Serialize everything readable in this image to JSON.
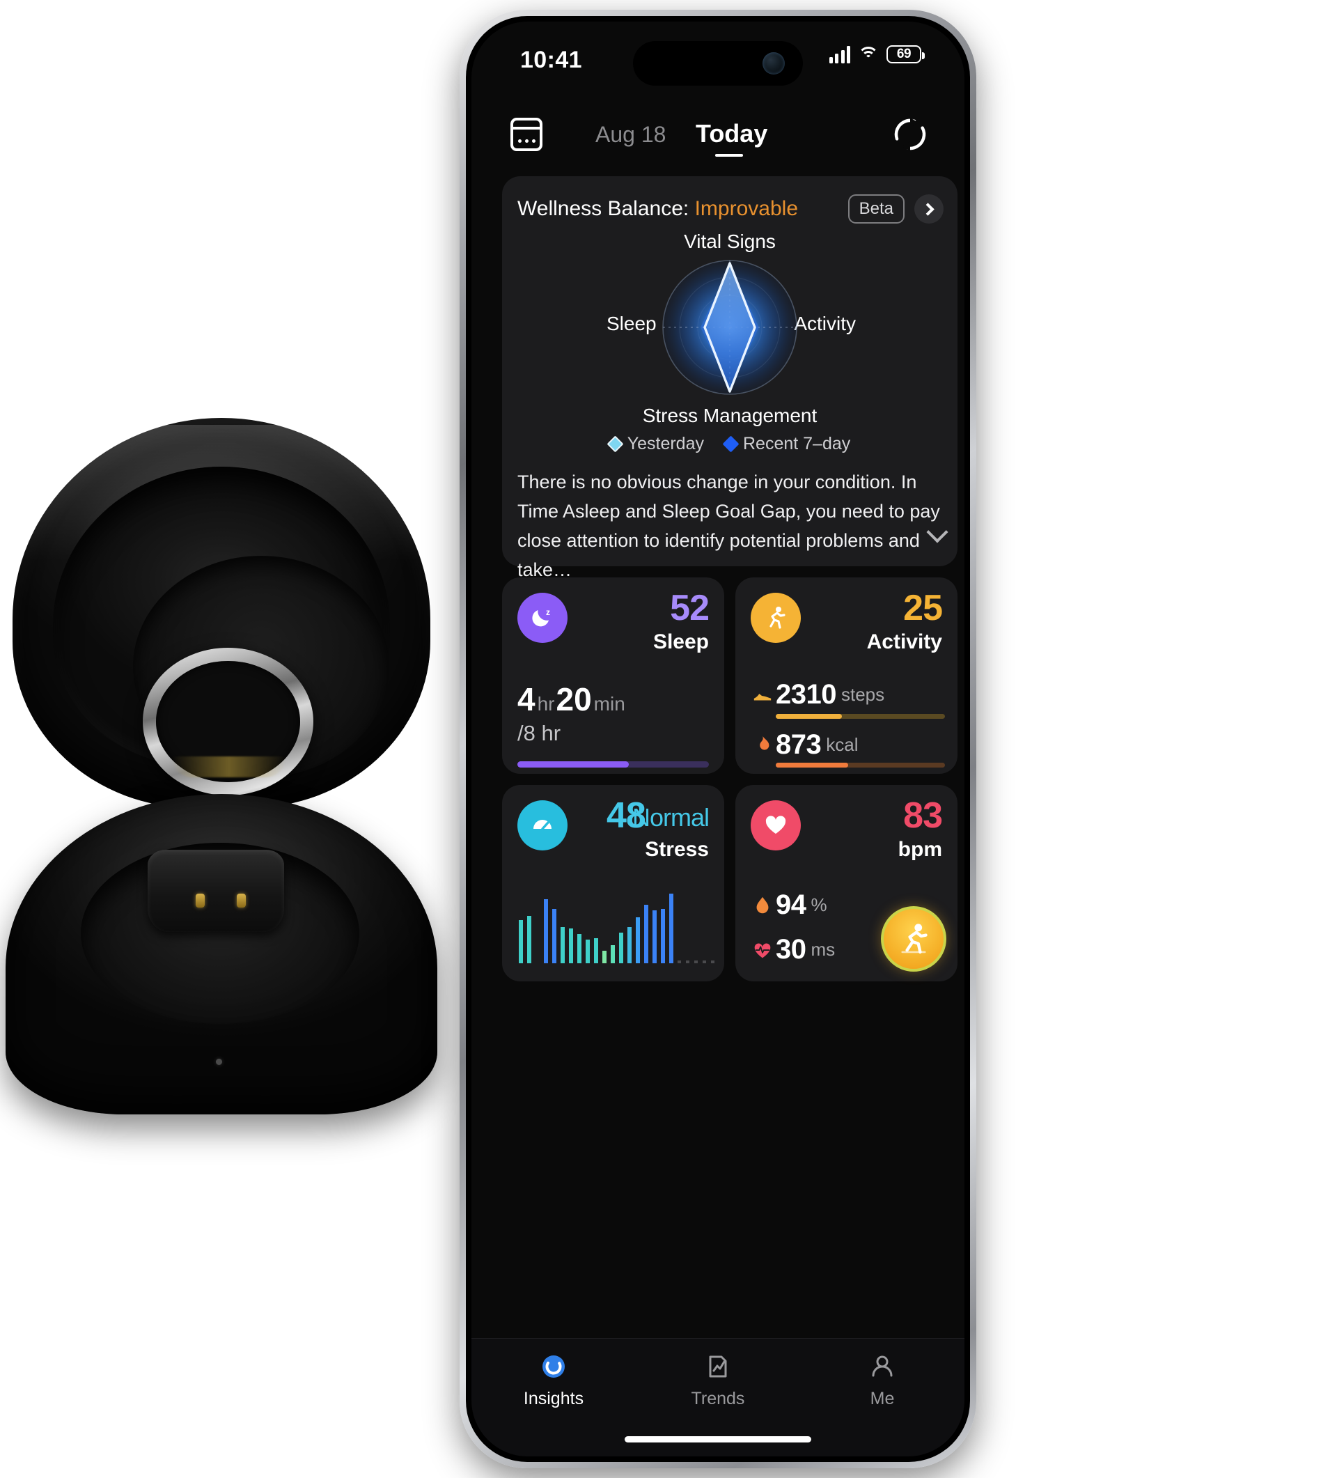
{
  "status_bar": {
    "time": "10:41",
    "battery_level": "69",
    "signal_icon": "cellular-signal-icon",
    "wifi_icon": "wifi-icon",
    "battery_icon": "battery-icon"
  },
  "header": {
    "calendar_icon": "calendar-icon",
    "previous_date": "Aug 18",
    "current_tab": "Today",
    "refresh_icon": "sync-refresh-icon"
  },
  "wellness": {
    "title_prefix": "Wellness Balance:",
    "status": "Improvable",
    "status_color": "#e8912f",
    "beta_badge": "Beta",
    "chevron_icon": "chevron-right-icon",
    "summary": "There is no obvious change in your condition. In Time Asleep and Sleep Goal Gap, you need to pay close attention to identify potential problems and take…",
    "expand_icon": "chevron-down-icon",
    "legend": [
      {
        "label": "Yesterday",
        "color": "#7fd6f0"
      },
      {
        "label": "Recent 7–day",
        "color": "#1f5ef5"
      }
    ],
    "chart_data": {
      "type": "radar",
      "title": "Wellness Balance",
      "categories": [
        "Vital Signs",
        "Activity",
        "Stress Management",
        "Sleep"
      ],
      "series": [
        {
          "name": "Yesterday",
          "color": "#7fd6f0",
          "values": [
            100,
            38,
            96,
            38
          ]
        },
        {
          "name": "Recent 7–day",
          "color": "#1f5ef5",
          "values": [
            92,
            44,
            90,
            44
          ]
        }
      ],
      "range": [
        0,
        100
      ],
      "grid": true,
      "legend_position": "bottom"
    }
  },
  "metrics": {
    "sleep": {
      "icon": "moon-sleep-icon",
      "icon_bg": "#8b5cf6",
      "score": "52",
      "score_color": "#a78bfa",
      "label": "Sleep",
      "duration_hours": "4",
      "hours_unit": "hr",
      "duration_minutes": "20",
      "minutes_unit": "min",
      "goal": "/8 hr",
      "progress_percent": 58,
      "bar_color": "#8b5cf6"
    },
    "activity": {
      "icon": "running-person-icon",
      "icon_bg": "#f5b335",
      "score": "25",
      "score_color": "#f5b335",
      "label": "Activity",
      "rows": [
        {
          "icon": "shoe-icon",
          "value": "2310",
          "unit": "steps",
          "progress_percent": 39,
          "color": "#f0b03c"
        },
        {
          "icon": "flame-icon",
          "value": "873",
          "unit": "kcal",
          "progress_percent": 43,
          "color": "#f07b3c"
        }
      ]
    },
    "stress": {
      "icon": "gauge-meter-icon",
      "icon_bg": "#28bede",
      "score": "48",
      "score_color": "#45c8e8",
      "state": "Normal",
      "label": "Stress",
      "chart_data": {
        "type": "bar",
        "title": "Stress",
        "values": [
          30,
          35,
          0,
          62,
          48,
          26,
          27,
          20,
          16,
          17,
          7,
          12,
          22,
          28,
          36,
          52,
          46,
          48,
          68
        ],
        "ylim": [
          0,
          70
        ],
        "grid": false,
        "xlabel": "",
        "ylabel": ""
      }
    },
    "heart": {
      "icon": "heart-icon",
      "icon_bg": "#f04b68",
      "value": "83",
      "value_color": "#f04b68",
      "unit": "bpm",
      "rows": [
        {
          "icon": "blood-drop-icon",
          "value": "94",
          "unit": "%"
        },
        {
          "icon": "heart-pulse-icon",
          "value": "30",
          "unit": "ms"
        }
      ],
      "fab_icon": "running-person-icon"
    }
  },
  "tabbar": {
    "items": [
      {
        "label": "Insights",
        "icon": "insights-ring-icon",
        "active": true
      },
      {
        "label": "Trends",
        "icon": "trends-chart-icon",
        "active": false
      },
      {
        "label": "Me",
        "icon": "person-icon",
        "active": false
      }
    ]
  }
}
